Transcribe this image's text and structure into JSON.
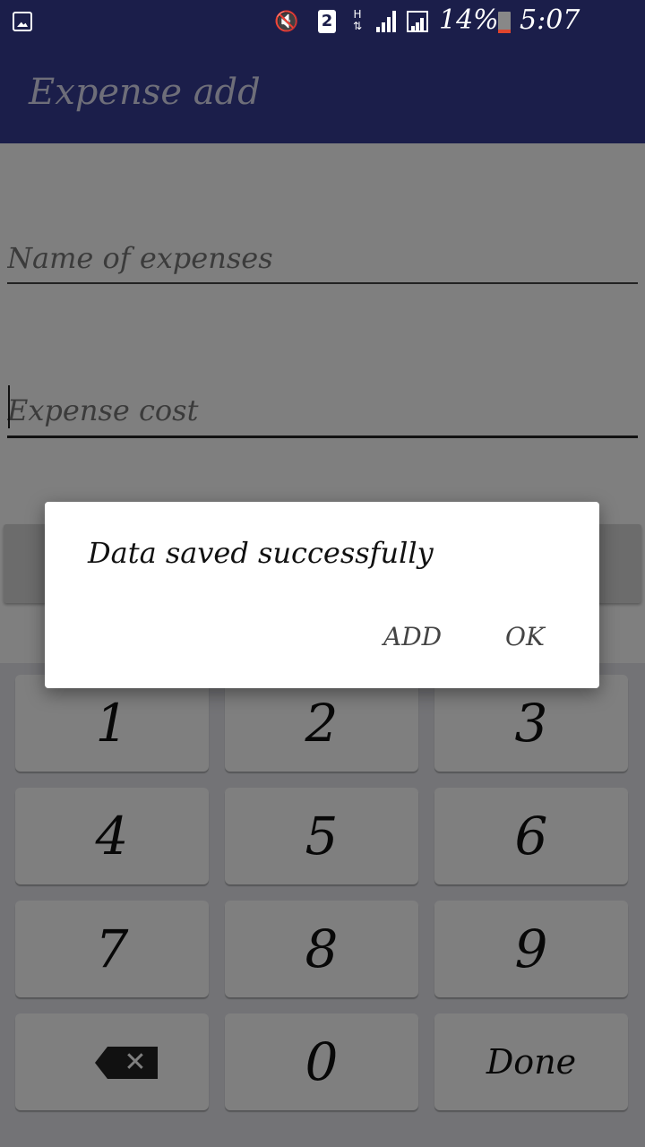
{
  "status_bar": {
    "sim_slot": "2",
    "network_type": "H",
    "battery_percent": "14%",
    "time": "5:07 p.m.",
    "icons": [
      "gallery-icon",
      "mute-icon",
      "sim-icon",
      "network-type-icon",
      "signal-icon",
      "signal-icon-2",
      "battery-icon"
    ]
  },
  "toolbar": {
    "title": "Expense add"
  },
  "form": {
    "name_placeholder": "Name of expenses",
    "cost_placeholder": "Expense cost"
  },
  "dialog": {
    "message": "Data saved successfully",
    "add_label": "ADD",
    "ok_label": "OK"
  },
  "keyboard": {
    "keys": [
      "1",
      "2",
      "3",
      "4",
      "5",
      "6",
      "7",
      "8",
      "9",
      "0"
    ],
    "backspace_symbol": "✕",
    "done_label": "Done"
  },
  "colors": {
    "primary_dark": "#1b1e4a",
    "scrim": "rgba(0,0,0,0.5)"
  }
}
